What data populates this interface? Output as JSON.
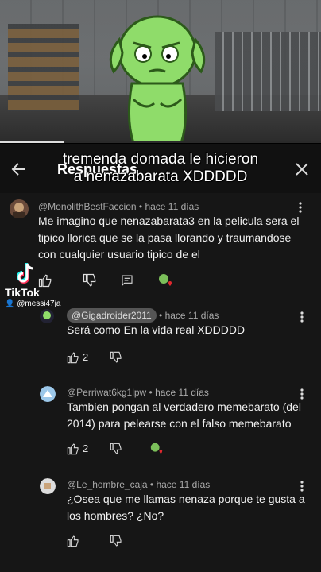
{
  "video": {
    "caption_line1": "tremenda domada le hicieron",
    "caption_line2": "a nenazabarata XDDDDD",
    "progress": 0.2
  },
  "header": {
    "title": "Respuestas"
  },
  "watermark": {
    "brand": "TikTok",
    "user": "@messi47ja"
  },
  "comments": [
    {
      "handle": "@MonolithBestFaccion",
      "sep": " • ",
      "time": "hace 11 días",
      "text_lines": [
        "Me imagino que nenazabarata3 en la pelicula sera el",
        "tipico llorica que se la pasa llorando y traumandose",
        "con cualquier usuario tipico de el"
      ]
    },
    {
      "handle": "@Gigadroider2011",
      "sep": " • ",
      "time": "hace 11 días",
      "text_lines": [
        "Será como En la vida real XDDDDD"
      ],
      "likes": "2"
    },
    {
      "handle": "@Perriwat6kg1lpw",
      "sep": " • ",
      "time": "hace 11 días",
      "text_lines": [
        "Tambien pongan al verdadero memebarato (del",
        "2014) para pelearse con el falso memebarato"
      ],
      "likes": "2"
    },
    {
      "handle": "@Le_hombre_caja",
      "sep": " • ",
      "time": "hace 11 días",
      "text_lines": [
        "¿Osea que me llamas nenaza porque te gusta a",
        "los hombres? ¿No?"
      ]
    }
  ],
  "icons": {
    "back": "arrow-left-icon",
    "close": "close-icon",
    "like": "thumb-up-icon",
    "dislike": "thumb-down-icon",
    "reply": "reply-icon",
    "menu": "more-vert-icon"
  },
  "colors": {
    "panel": "#161616",
    "character_green": "#8fdc6a"
  }
}
